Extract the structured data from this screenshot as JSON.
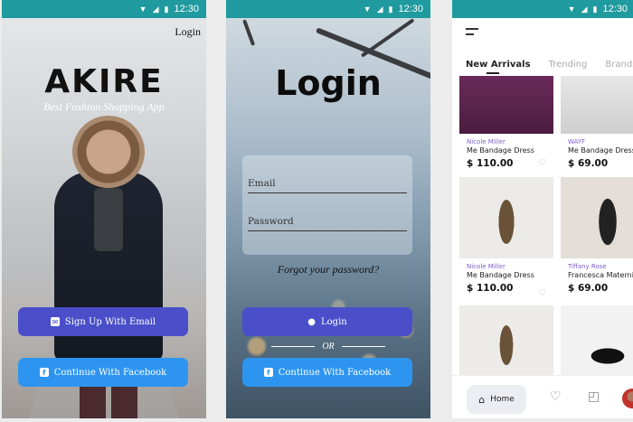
{
  "status_bar": {
    "time": "12:30"
  },
  "screen1": {
    "login_link": "Login",
    "app_name": "AKIRE",
    "tagline": "Best Fashion Shopping App",
    "signup_email": "Sign Up With Email",
    "continue_facebook": "Continue With Facebook"
  },
  "screen2": {
    "title": "Login",
    "email_placeholder": "Email",
    "password_placeholder": "Password",
    "forgot_password": "Forgot your password?",
    "login_button": "Login",
    "or": "OR",
    "continue_facebook": "Continue With Facebook"
  },
  "screen3": {
    "tabs": [
      {
        "label": "New Arrivals",
        "active": true
      },
      {
        "label": "Trending",
        "active": false
      },
      {
        "label": "Brands",
        "active": false
      }
    ],
    "products": [
      {
        "brand": "",
        "name": "",
        "price": "",
        "color": "#6b2a5a"
      },
      {
        "brand": "",
        "name": "",
        "price": "",
        "color": "#dcdcdc"
      },
      {
        "brand": "Nicole Miller",
        "name": "Me Bandage Dress",
        "price": "$ 110.00",
        "color": "#e8e6e2"
      },
      {
        "brand": "WAYF",
        "name": "Me Bandage Dress",
        "price": "$ 69.00",
        "color": "#d8d4cf"
      },
      {
        "brand": "Nicole Miller",
        "name": "Me Bandage Dress",
        "price": "$ 110.00",
        "color": "#e9e7e3"
      },
      {
        "brand": "Tiffany Rose",
        "name": "Francesca Maternity",
        "price": "$ 69.00",
        "color": "#e2dcd6"
      }
    ],
    "bottom_nav": {
      "home_label": "Home"
    }
  }
}
